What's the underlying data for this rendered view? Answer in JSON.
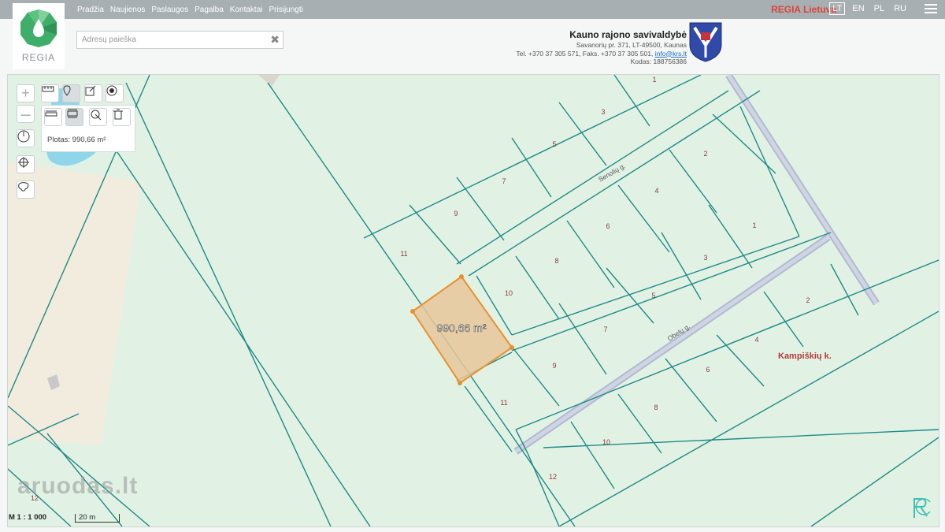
{
  "nav": {
    "items": [
      "Pradžia",
      "Naujienos",
      "Paslaugos",
      "Pagalba",
      "Kontaktai",
      "Prisijungti"
    ]
  },
  "brand": "REGIA Lietuva",
  "languages": {
    "active": "LT",
    "others": [
      "EN",
      "PL",
      "RU"
    ]
  },
  "logo": {
    "label": "REGIA"
  },
  "search": {
    "placeholder": "Adresų paieška",
    "value": "",
    "clear_icon": "close-icon"
  },
  "municipality": {
    "name": "Kauno rajono savivaldybė",
    "address": "Savanorių pr. 371, LT-49500, Kaunas",
    "phone": "Tel. +370 37 305 571, Faks. +370 37 305 501,",
    "email": "info@krs.lt",
    "code": "Kodas: 188756386"
  },
  "tools": {
    "zoom_in": "+",
    "zoom_out": "—",
    "area_label": "Plotas: 990,66 m²"
  },
  "map": {
    "selected_area": "990,66 m²",
    "village": "Kampiškių k.",
    "streets": [
      "Senolių g.",
      "Obelų g."
    ],
    "parcel_labels": [
      "1",
      "3",
      "5",
      "2",
      "7",
      "4",
      "9",
      "6",
      "1",
      "11",
      "8",
      "3",
      "10",
      "5",
      "7",
      "2",
      "4",
      "9",
      "6",
      "11",
      "8",
      "10",
      "12",
      "12"
    ]
  },
  "scale": {
    "ratio": "M 1 : 1 000",
    "bar": "20 m"
  },
  "watermark": "aruodas.lt",
  "colors": {
    "brand": "#d9443a",
    "parcel_line": "#1f8a85",
    "selection": "#e8902b",
    "map_bg": "#e1f2e5"
  }
}
